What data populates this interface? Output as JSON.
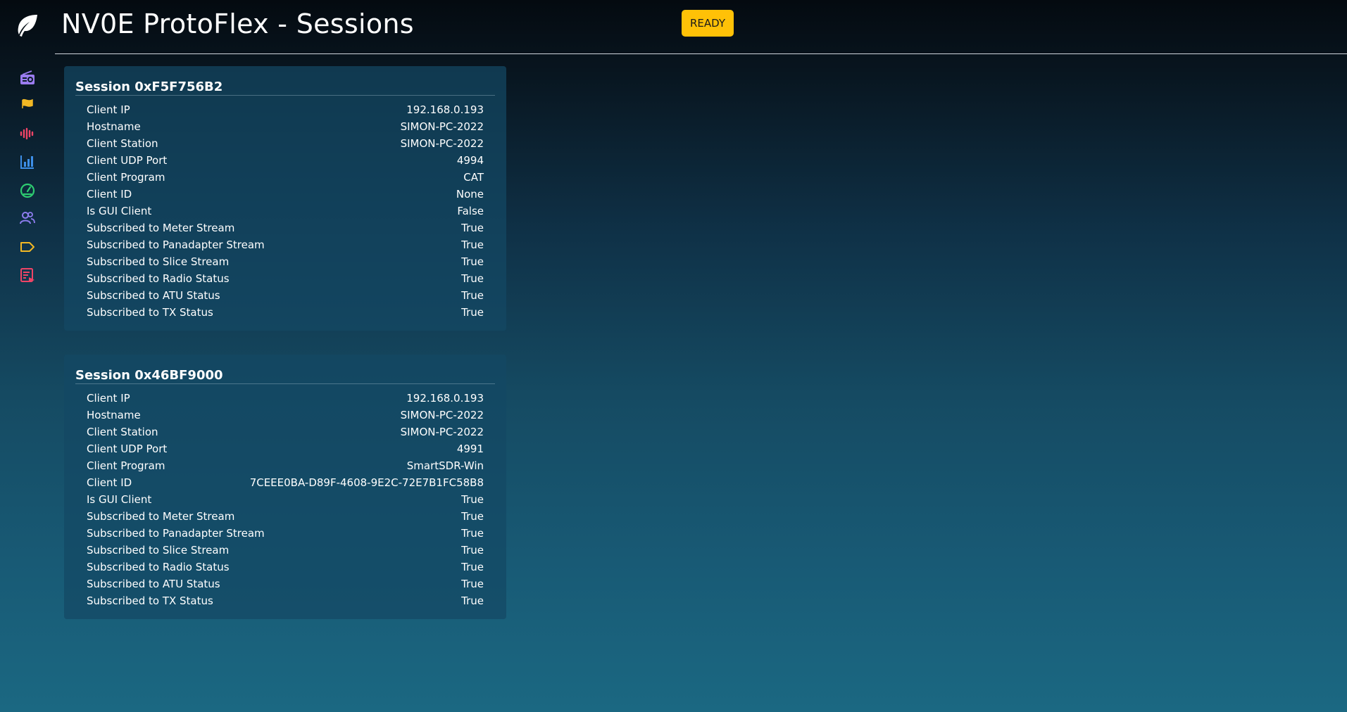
{
  "header": {
    "title": "NV0E ProtoFlex - Sessions",
    "status_badge": "READY"
  },
  "sidebar": {
    "logo_icon": "feather-leaf-icon",
    "items": [
      {
        "icon": "radio-icon",
        "color": "#9b7cf0"
      },
      {
        "icon": "flag-icon",
        "color": "#f2b824"
      },
      {
        "icon": "waveform-icon",
        "color": "#ef4466"
      },
      {
        "icon": "bar-chart-icon",
        "color": "#3d8fe8"
      },
      {
        "icon": "speedometer-icon",
        "color": "#2ecc71"
      },
      {
        "icon": "users-icon",
        "color": "#8e7df0"
      },
      {
        "icon": "tag-icon",
        "color": "#f2b824"
      },
      {
        "icon": "list-check-icon",
        "color": "#ef4466"
      }
    ]
  },
  "sessions": [
    {
      "title": "Session 0xF5F756B2",
      "rows": [
        {
          "key": "Client IP",
          "value": "192.168.0.193"
        },
        {
          "key": "Hostname",
          "value": "SIMON-PC-2022"
        },
        {
          "key": "Client Station",
          "value": "SIMON-PC-2022"
        },
        {
          "key": "Client UDP Port",
          "value": "4994"
        },
        {
          "key": "Client Program",
          "value": "CAT"
        },
        {
          "key": "Client ID",
          "value": "None"
        },
        {
          "key": "Is GUI Client",
          "value": "False"
        },
        {
          "key": "Subscribed to Meter Stream",
          "value": "True"
        },
        {
          "key": "Subscribed to Panadapter Stream",
          "value": "True"
        },
        {
          "key": "Subscribed to Slice Stream",
          "value": "True"
        },
        {
          "key": "Subscribed to Radio Status",
          "value": "True"
        },
        {
          "key": "Subscribed to ATU Status",
          "value": "True"
        },
        {
          "key": "Subscribed to TX Status",
          "value": "True"
        }
      ]
    },
    {
      "title": "Session 0x46BF9000",
      "rows": [
        {
          "key": "Client IP",
          "value": "192.168.0.193"
        },
        {
          "key": "Hostname",
          "value": "SIMON-PC-2022"
        },
        {
          "key": "Client Station",
          "value": "SIMON-PC-2022"
        },
        {
          "key": "Client UDP Port",
          "value": "4991"
        },
        {
          "key": "Client Program",
          "value": "SmartSDR-Win"
        },
        {
          "key": "Client ID",
          "value": "7CEEE0BA-D89F-4608-9E2C-72E7B1FC58B8"
        },
        {
          "key": "Is GUI Client",
          "value": "True"
        },
        {
          "key": "Subscribed to Meter Stream",
          "value": "True"
        },
        {
          "key": "Subscribed to Panadapter Stream",
          "value": "True"
        },
        {
          "key": "Subscribed to Slice Stream",
          "value": "True"
        },
        {
          "key": "Subscribed to Radio Status",
          "value": "True"
        },
        {
          "key": "Subscribed to ATU Status",
          "value": "True"
        },
        {
          "key": "Subscribed to TX Status",
          "value": "True"
        }
      ]
    }
  ]
}
